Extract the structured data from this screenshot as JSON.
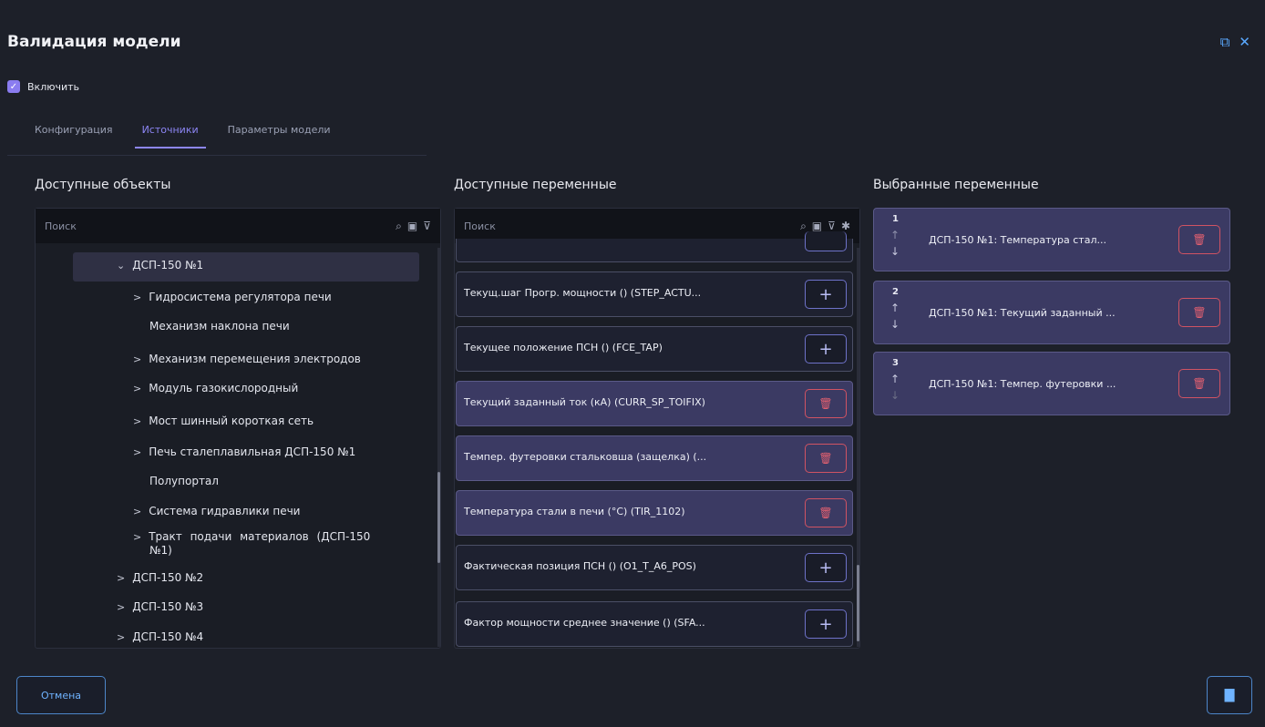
{
  "dialog": {
    "title": "Валидация модели",
    "enable_label": "Включить",
    "tabs": [
      "Конфигурация",
      "Источники",
      "Параметры модели"
    ]
  },
  "columns": {
    "available_objects": "Доступные объекты",
    "available_variables": "Доступные переменные",
    "selected_variables": "Выбранные переменные"
  },
  "search": {
    "placeholder": "Поиск"
  },
  "tree": [
    {
      "label": "ДСП-150 №1",
      "chevron": "⌄",
      "level": 1
    },
    {
      "label": "Гидросистема регулятора печи",
      "chevron": ">",
      "level": 2
    },
    {
      "label": "Механизм наклона печи",
      "chevron": "",
      "level": 2
    },
    {
      "label": "Механизм перемещения электродов",
      "chevron": ">",
      "level": 2
    },
    {
      "label": "Модуль газокислородный",
      "chevron": ">",
      "level": 2
    },
    {
      "label": "Мост шинный короткая сеть",
      "chevron": ">",
      "level": 2
    },
    {
      "label": "Печь сталеплавильная ДСП-150 №1",
      "chevron": ">",
      "level": 2
    },
    {
      "label": "Полупортал",
      "chevron": "",
      "level": 2
    },
    {
      "label": "Система гидравлики печи",
      "chevron": ">",
      "level": 2
    },
    {
      "label": "Тракт подачи материалов (ДСП-150",
      "label2": "№1)",
      "chevron": ">",
      "level": 2
    },
    {
      "label": "ДСП-150 №2",
      "chevron": ">",
      "level": 1
    },
    {
      "label": "ДСП-150 №3",
      "chevron": ">",
      "level": 1
    },
    {
      "label": "ДСП-150 №4",
      "chevron": ">",
      "level": 1
    }
  ],
  "variables": [
    {
      "label": "Текущ.шаг Прогр. мощности () (STEP_ACTU...",
      "selected": false
    },
    {
      "label": "Текущее положение ПСН () (FCE_TAP)",
      "selected": false
    },
    {
      "label": "Текущий заданный ток (кА) (CURR_SP_TOIFIX)",
      "selected": true
    },
    {
      "label": "Темпер. футеровки стальковша (защелка) (...",
      "selected": true
    },
    {
      "label": "Температура стали в печи (°C) (TIR_1102)",
      "selected": true
    },
    {
      "label": "Фактическая позиция ПСН () (O1_T_A6_POS)",
      "selected": false
    },
    {
      "label": "Фактор мощности среднее значение () (SFA...",
      "selected": false
    }
  ],
  "selected": [
    {
      "num": "1",
      "label": "ДСП-150 №1: Температура стал..."
    },
    {
      "num": "2",
      "label": "ДСП-150 №1: Текущий заданный ..."
    },
    {
      "num": "3",
      "label": "ДСП-150 №1: Темпер. футеровки ..."
    }
  ],
  "footer": {
    "cancel": "Отмена"
  }
}
